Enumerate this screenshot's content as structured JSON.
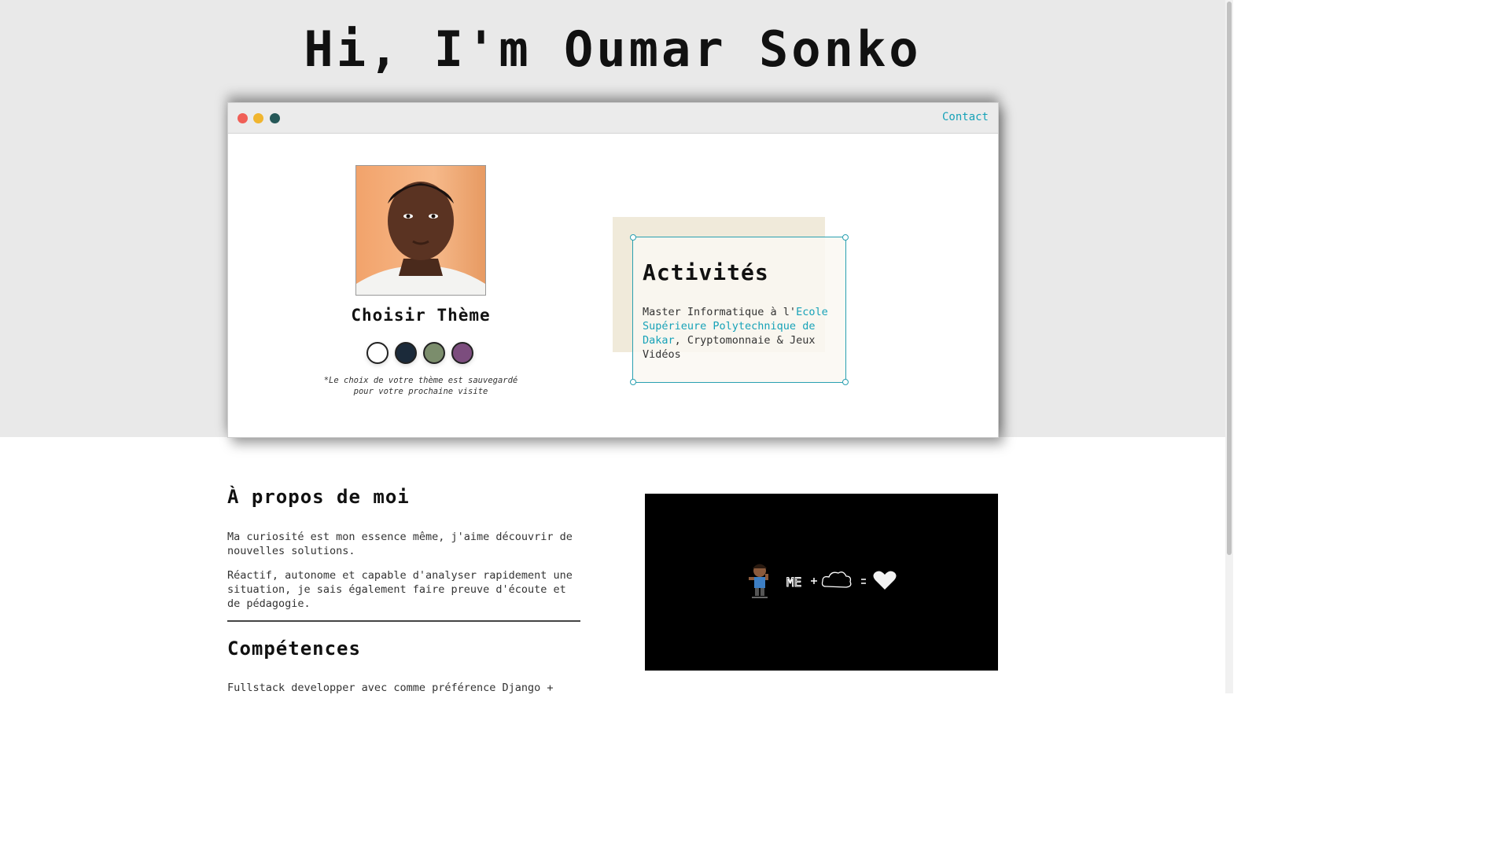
{
  "hero": {
    "title": "Hi, I'm Oumar Sonko"
  },
  "window": {
    "contact_label": "Contact",
    "theme_title": "Choisir Thème",
    "theme_note": "*Le choix de votre thème est sauvegardé pour votre prochaine visite",
    "swatches": [
      {
        "name": "white",
        "color": "#ffffff"
      },
      {
        "name": "dark-navy",
        "color": "#1b2a3a"
      },
      {
        "name": "sage-green",
        "color": "#7b8d6c"
      },
      {
        "name": "purple",
        "color": "#7c4d7e"
      }
    ],
    "activities": {
      "title": "Activités",
      "text_before": "Master Informatique à l'",
      "text_link": "Ecole Supérieure Polytechnique de Dakar",
      "text_after": ", Cryptomonnaie & Jeux Vidéos"
    }
  },
  "about": {
    "title": "À propos de moi",
    "p1": "Ma curiosité est mon essence même, j'aime découvrir de nouvelles solutions.",
    "p2": "Réactif, autonome et capable d'analyser rapidement une situation, je sais également faire preuve d'écoute et de pédagogie."
  },
  "skills": {
    "title": "Compétences",
    "p1": "Fullstack developper avec comme préférence Django +"
  },
  "video": {
    "banner_text": "ME"
  },
  "colors": {
    "accent": "#17a2b8",
    "hero_bg": "#e9e9e9",
    "dot_red": "#f05f57",
    "dot_yellow": "#f0b52f",
    "dot_teal": "#265858"
  }
}
